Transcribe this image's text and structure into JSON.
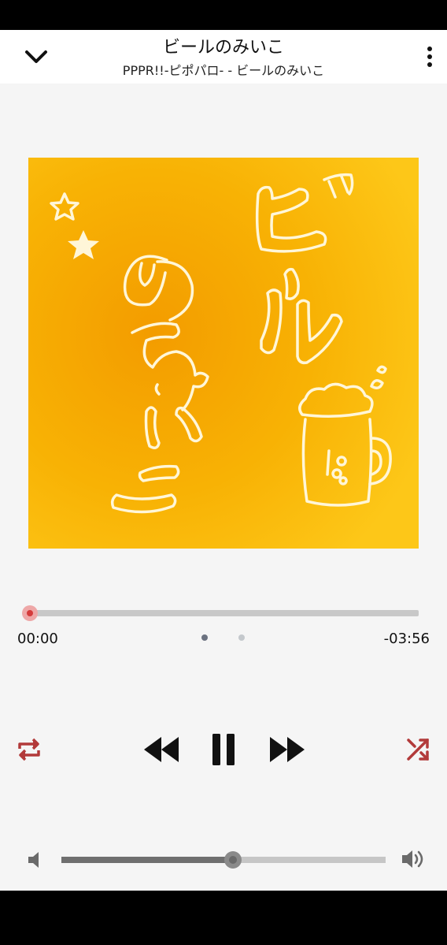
{
  "header": {
    "title": "ビールのみいこ",
    "subtitle": "PPPR!!-ピポパロ- - ビールのみいこ",
    "back_icon": "chevron-down-icon",
    "menu_icon": "more-vertical-icon"
  },
  "album_art": {
    "text": "ビールのみいこ",
    "background_color": "#f7b000"
  },
  "playback": {
    "elapsed": "00:00",
    "remaining": "-03:56",
    "progress": 0
  },
  "pager": {
    "pages": 2,
    "active_index": 0
  },
  "controls": {
    "repeat_icon": "repeat-icon",
    "rewind_icon": "rewind-icon",
    "pause_icon": "pause-icon",
    "fast_forward_icon": "fast-forward-icon",
    "shuffle_icon": "shuffle-icon",
    "accent_color": "#b23a3a"
  },
  "volume": {
    "level": 0.53,
    "mute_icon": "volume-low-icon",
    "max_icon": "volume-high-icon"
  }
}
